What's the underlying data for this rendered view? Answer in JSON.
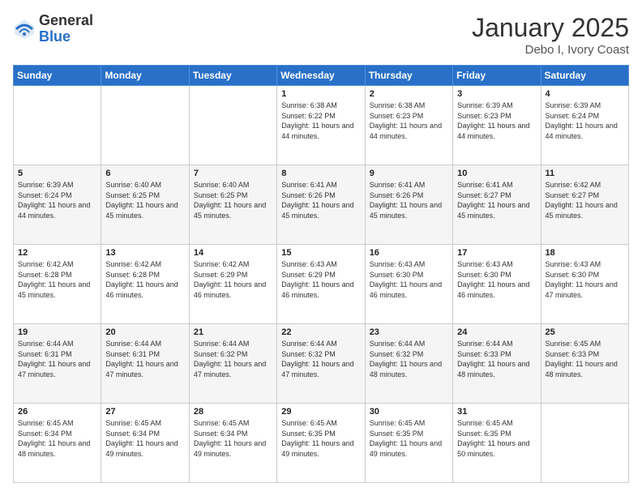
{
  "header": {
    "logo_general": "General",
    "logo_blue": "Blue",
    "month_title": "January 2025",
    "location": "Debo I, Ivory Coast"
  },
  "calendar": {
    "days_of_week": [
      "Sunday",
      "Monday",
      "Tuesday",
      "Wednesday",
      "Thursday",
      "Friday",
      "Saturday"
    ],
    "weeks": [
      [
        {
          "day": "",
          "info": ""
        },
        {
          "day": "",
          "info": ""
        },
        {
          "day": "",
          "info": ""
        },
        {
          "day": "1",
          "info": "Sunrise: 6:38 AM\nSunset: 6:22 PM\nDaylight: 11 hours and 44 minutes."
        },
        {
          "day": "2",
          "info": "Sunrise: 6:38 AM\nSunset: 6:23 PM\nDaylight: 11 hours and 44 minutes."
        },
        {
          "day": "3",
          "info": "Sunrise: 6:39 AM\nSunset: 6:23 PM\nDaylight: 11 hours and 44 minutes."
        },
        {
          "day": "4",
          "info": "Sunrise: 6:39 AM\nSunset: 6:24 PM\nDaylight: 11 hours and 44 minutes."
        }
      ],
      [
        {
          "day": "5",
          "info": "Sunrise: 6:39 AM\nSunset: 6:24 PM\nDaylight: 11 hours and 44 minutes."
        },
        {
          "day": "6",
          "info": "Sunrise: 6:40 AM\nSunset: 6:25 PM\nDaylight: 11 hours and 45 minutes."
        },
        {
          "day": "7",
          "info": "Sunrise: 6:40 AM\nSunset: 6:25 PM\nDaylight: 11 hours and 45 minutes."
        },
        {
          "day": "8",
          "info": "Sunrise: 6:41 AM\nSunset: 6:26 PM\nDaylight: 11 hours and 45 minutes."
        },
        {
          "day": "9",
          "info": "Sunrise: 6:41 AM\nSunset: 6:26 PM\nDaylight: 11 hours and 45 minutes."
        },
        {
          "day": "10",
          "info": "Sunrise: 6:41 AM\nSunset: 6:27 PM\nDaylight: 11 hours and 45 minutes."
        },
        {
          "day": "11",
          "info": "Sunrise: 6:42 AM\nSunset: 6:27 PM\nDaylight: 11 hours and 45 minutes."
        }
      ],
      [
        {
          "day": "12",
          "info": "Sunrise: 6:42 AM\nSunset: 6:28 PM\nDaylight: 11 hours and 45 minutes."
        },
        {
          "day": "13",
          "info": "Sunrise: 6:42 AM\nSunset: 6:28 PM\nDaylight: 11 hours and 46 minutes."
        },
        {
          "day": "14",
          "info": "Sunrise: 6:42 AM\nSunset: 6:29 PM\nDaylight: 11 hours and 46 minutes."
        },
        {
          "day": "15",
          "info": "Sunrise: 6:43 AM\nSunset: 6:29 PM\nDaylight: 11 hours and 46 minutes."
        },
        {
          "day": "16",
          "info": "Sunrise: 6:43 AM\nSunset: 6:30 PM\nDaylight: 11 hours and 46 minutes."
        },
        {
          "day": "17",
          "info": "Sunrise: 6:43 AM\nSunset: 6:30 PM\nDaylight: 11 hours and 46 minutes."
        },
        {
          "day": "18",
          "info": "Sunrise: 6:43 AM\nSunset: 6:30 PM\nDaylight: 11 hours and 47 minutes."
        }
      ],
      [
        {
          "day": "19",
          "info": "Sunrise: 6:44 AM\nSunset: 6:31 PM\nDaylight: 11 hours and 47 minutes."
        },
        {
          "day": "20",
          "info": "Sunrise: 6:44 AM\nSunset: 6:31 PM\nDaylight: 11 hours and 47 minutes."
        },
        {
          "day": "21",
          "info": "Sunrise: 6:44 AM\nSunset: 6:32 PM\nDaylight: 11 hours and 47 minutes."
        },
        {
          "day": "22",
          "info": "Sunrise: 6:44 AM\nSunset: 6:32 PM\nDaylight: 11 hours and 47 minutes."
        },
        {
          "day": "23",
          "info": "Sunrise: 6:44 AM\nSunset: 6:32 PM\nDaylight: 11 hours and 48 minutes."
        },
        {
          "day": "24",
          "info": "Sunrise: 6:44 AM\nSunset: 6:33 PM\nDaylight: 11 hours and 48 minutes."
        },
        {
          "day": "25",
          "info": "Sunrise: 6:45 AM\nSunset: 6:33 PM\nDaylight: 11 hours and 48 minutes."
        }
      ],
      [
        {
          "day": "26",
          "info": "Sunrise: 6:45 AM\nSunset: 6:34 PM\nDaylight: 11 hours and 48 minutes."
        },
        {
          "day": "27",
          "info": "Sunrise: 6:45 AM\nSunset: 6:34 PM\nDaylight: 11 hours and 49 minutes."
        },
        {
          "day": "28",
          "info": "Sunrise: 6:45 AM\nSunset: 6:34 PM\nDaylight: 11 hours and 49 minutes."
        },
        {
          "day": "29",
          "info": "Sunrise: 6:45 AM\nSunset: 6:35 PM\nDaylight: 11 hours and 49 minutes."
        },
        {
          "day": "30",
          "info": "Sunrise: 6:45 AM\nSunset: 6:35 PM\nDaylight: 11 hours and 49 minutes."
        },
        {
          "day": "31",
          "info": "Sunrise: 6:45 AM\nSunset: 6:35 PM\nDaylight: 11 hours and 50 minutes."
        },
        {
          "day": "",
          "info": ""
        }
      ]
    ]
  }
}
